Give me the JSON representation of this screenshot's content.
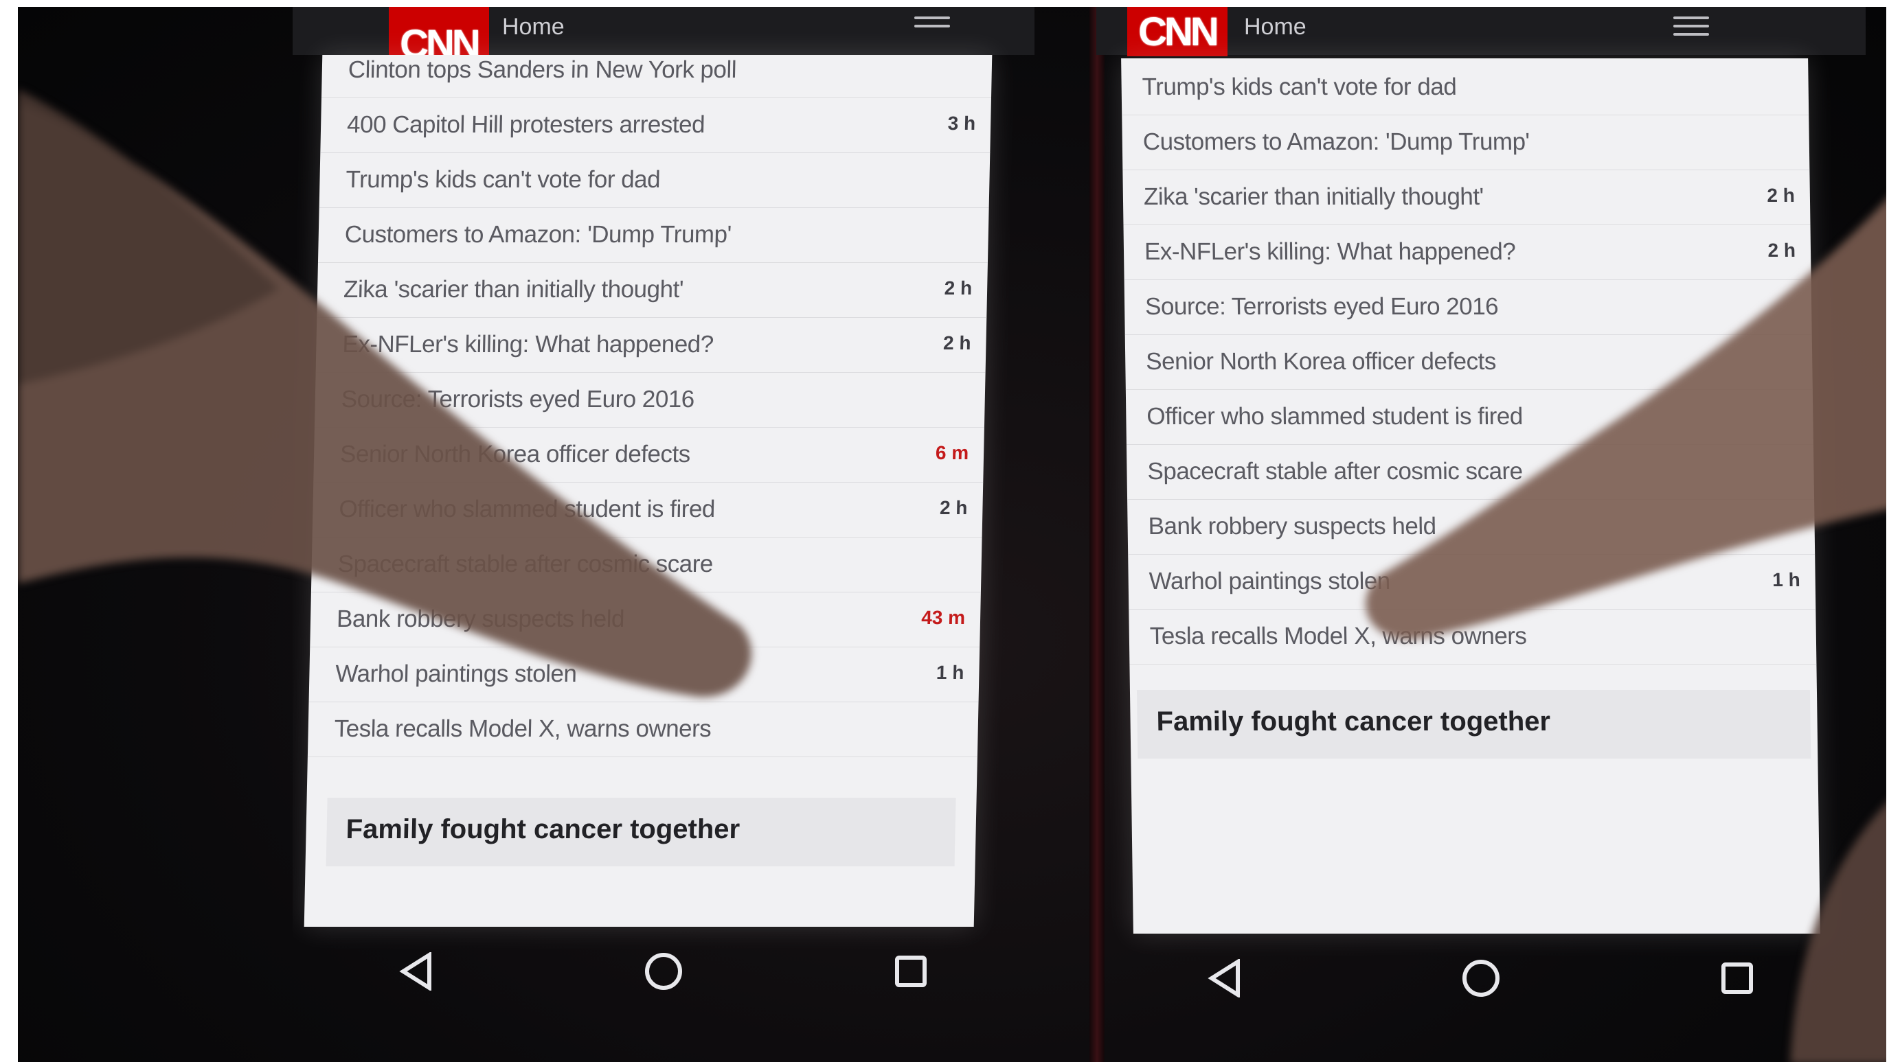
{
  "left_phone": {
    "header": {
      "logo": "CNN",
      "section": "Home"
    },
    "headlines": [
      {
        "text": "Clinton tops Sanders in New York poll",
        "time": ""
      },
      {
        "text": "400 Capitol Hill protesters arrested",
        "time": "3 h"
      },
      {
        "text": "Trump's kids can't vote for dad",
        "time": ""
      },
      {
        "text": "Customers to Amazon: 'Dump Trump'",
        "time": ""
      },
      {
        "text": "Zika 'scarier than initially thought'",
        "time": "2 h"
      },
      {
        "text": "Ex-NFLer's killing: What happened?",
        "time": "2 h"
      },
      {
        "text": "Source: Terrorists eyed Euro 2016",
        "time": ""
      },
      {
        "text": "Senior North Korea officer defects",
        "time": "6 m"
      },
      {
        "text": "Officer who slammed student is fired",
        "time": "2 h"
      },
      {
        "text": "Spacecraft stable after cosmic scare",
        "time": ""
      },
      {
        "text": "Bank robbery suspects held",
        "time": "43 m"
      },
      {
        "text": "Warhol paintings stolen",
        "time": "1 h"
      },
      {
        "text": "Tesla recalls Model X, warns owners",
        "time": ""
      }
    ],
    "feature": "Family fought cancer together"
  },
  "right_phone": {
    "header": {
      "logo": "CNN",
      "section": "Home"
    },
    "headlines": [
      {
        "text": "Trump's kids can't vote for dad",
        "time": ""
      },
      {
        "text": "Customers to Amazon: 'Dump Trump'",
        "time": ""
      },
      {
        "text": "Zika 'scarier than initially thought'",
        "time": "2 h"
      },
      {
        "text": "Ex-NFLer's killing: What happened?",
        "time": "2 h"
      },
      {
        "text": "Source: Terrorists eyed Euro 2016",
        "time": ""
      },
      {
        "text": "Senior North Korea officer defects",
        "time": ""
      },
      {
        "text": "Officer who slammed student is fired",
        "time": ""
      },
      {
        "text": "Spacecraft stable after cosmic scare",
        "time": ""
      },
      {
        "text": "Bank robbery suspects held",
        "time": ""
      },
      {
        "text": "Warhol paintings stolen",
        "time": "1 h"
      },
      {
        "text": "Tesla recalls Model X, warns owners",
        "time": ""
      }
    ],
    "feature": "Family fought cancer together"
  },
  "nav_icons": [
    "back-icon",
    "home-icon",
    "recents-icon"
  ],
  "colors": {
    "brand_red": "#cc0000",
    "recent_time": "#c41a1a"
  }
}
